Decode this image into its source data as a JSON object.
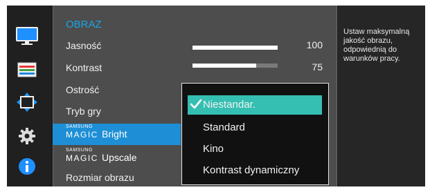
{
  "menu": {
    "title": "OBRAZ",
    "items": [
      {
        "label": "Jasność",
        "value": 100,
        "level_pct": 100
      },
      {
        "label": "Kontrast",
        "value": 75,
        "level_pct": 75
      },
      {
        "label": "Ostrość"
      },
      {
        "label": "Tryb gry"
      },
      {
        "brand": "SAMSUNG",
        "brand_big": "MAGIC",
        "label": "Bright",
        "selected": true
      },
      {
        "brand": "SAMSUNG",
        "brand_big": "MAGIC",
        "label": "Upscale"
      },
      {
        "label": "Rozmiar obrazu"
      }
    ]
  },
  "dropdown": {
    "options": [
      "Niestandar.",
      "Standard",
      "Kino",
      "Kontrast dynamiczny"
    ],
    "selected_index": 0,
    "check_mark": "✓"
  },
  "description": "Ustaw maksymalną jakość obrazu, odpowiednią do warunków pracy.",
  "nav_icons": [
    "monitor-icon",
    "color-bars-icon",
    "resize-icon",
    "gear-icon",
    "info-icon"
  ],
  "colors": {
    "accent_blue": "#1aa6e6",
    "selected_row": "#1e8fd6",
    "selected_option": "#35bfb2"
  }
}
